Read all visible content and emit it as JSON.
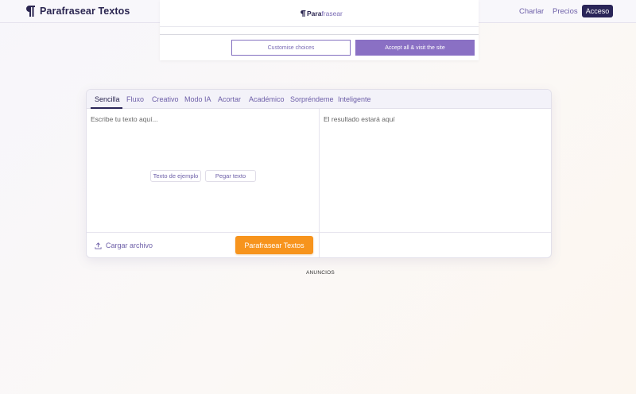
{
  "header": {
    "logo_text": "Parafrasear Textos",
    "nav": {
      "charlar": "Charlar",
      "precios": "Precios",
      "acceso": "Acceso"
    }
  },
  "consent": {
    "logo_part1": "Para",
    "logo_part2": "frasear",
    "customise_label": "Customise choices",
    "accept_label": "Accept all & visit the site"
  },
  "editor": {
    "tabs": [
      {
        "label": "Sencilla",
        "active": true
      },
      {
        "label": "Fluxo"
      },
      {
        "label": "Creativo"
      },
      {
        "label": "Modo IA"
      },
      {
        "label": "Acortar"
      },
      {
        "label": "Académico"
      },
      {
        "label": "Sorpréndeme"
      },
      {
        "label": "Inteligente"
      }
    ],
    "input_placeholder": "Escribe tu texto aquí...",
    "output_placeholder": "El resultado estará aquí",
    "sample_label": "Texto de ejemplo",
    "paste_label": "Pegar texto",
    "upload_label": "Cargar archivo",
    "submit_label": "Parafrasear Textos"
  },
  "ads_label": "ANUNCIOS",
  "colors": {
    "primary_dark": "#2a2558",
    "accent_purple": "#8a70c4",
    "cta_orange": "#f7941d"
  },
  "icons": {
    "logo": "pilcrow-icon",
    "upload": "upload-icon"
  }
}
